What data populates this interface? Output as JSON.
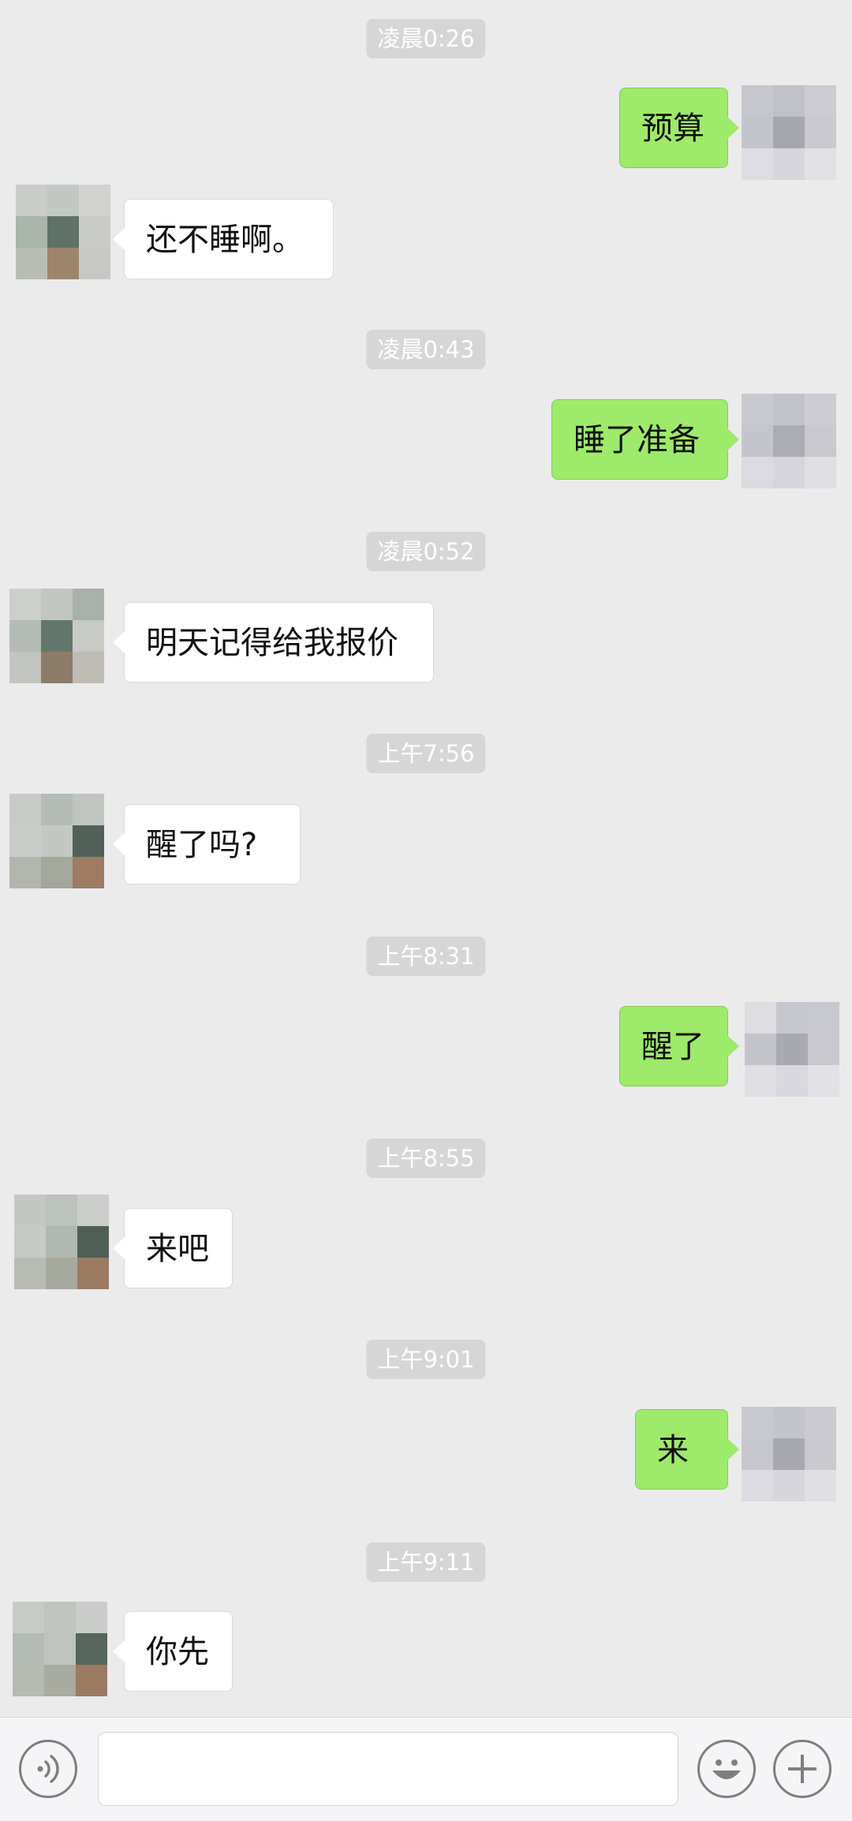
{
  "messages": [
    {
      "type": "time",
      "text": "凌晨0:26"
    },
    {
      "type": "out",
      "text": "预算"
    },
    {
      "type": "in",
      "text": "还不睡啊。"
    },
    {
      "type": "time",
      "text": "凌晨0:43"
    },
    {
      "type": "out",
      "text": "睡了准备"
    },
    {
      "type": "time",
      "text": "凌晨0:52"
    },
    {
      "type": "in",
      "text": "明天记得给我报价"
    },
    {
      "type": "time",
      "text": "上午7:56"
    },
    {
      "type": "in",
      "text": "醒了吗?"
    },
    {
      "type": "time",
      "text": "上午8:31"
    },
    {
      "type": "out",
      "text": "醒了"
    },
    {
      "type": "time",
      "text": "上午8:55"
    },
    {
      "type": "in",
      "text": "来吧"
    },
    {
      "type": "time",
      "text": "上午9:01"
    },
    {
      "type": "out",
      "text": "来"
    },
    {
      "type": "time",
      "text": "上午9:11"
    },
    {
      "type": "in",
      "text": "你先"
    }
  ],
  "input_bar": {
    "voice_icon": "voice-icon",
    "emoji_icon": "emoji-icon",
    "plus_icon": "plus-icon",
    "text_value": ""
  },
  "colors": {
    "background": "#ebebeb",
    "outgoing_bubble": "#9eea6a",
    "incoming_bubble": "#ffffff",
    "timestamp_bg": "#d6d6d6"
  }
}
